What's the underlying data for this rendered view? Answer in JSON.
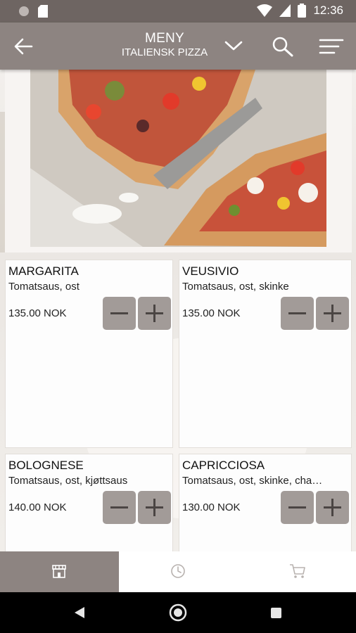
{
  "status_bar": {
    "time": "12:36"
  },
  "app_bar": {
    "title": "MENY",
    "subtitle": "ITALIENSK PIZZA"
  },
  "menu_items": [
    {
      "name": "MARGARITA",
      "desc": "Tomatsaus, ost",
      "price": "135.00 NOK"
    },
    {
      "name": "VEUSIVIO",
      "desc": "Tomatsaus, ost, skinke",
      "price": "135.00 NOK"
    },
    {
      "name": "BOLOGNESE",
      "desc": "Tomatsaus, ost, kjøttsaus",
      "price": "140.00 NOK"
    },
    {
      "name": "CAPRICCIOSA",
      "desc": "Tomatsaus, ost, skinke, cha…",
      "price": "130.00 NOK"
    }
  ],
  "icons": {
    "back": "arrow-left-icon",
    "dropdown": "chevron-down-icon",
    "search": "search-icon",
    "menu": "menu-lines-icon",
    "minus": "minus-icon",
    "plus": "plus-icon",
    "store": "store-icon",
    "clock": "clock-icon",
    "cart": "cart-icon"
  },
  "colors": {
    "app_bar": "#8d8481",
    "status_bar": "#6e6562",
    "stepper": "#a29b98",
    "active_tab": "#8d8481"
  }
}
